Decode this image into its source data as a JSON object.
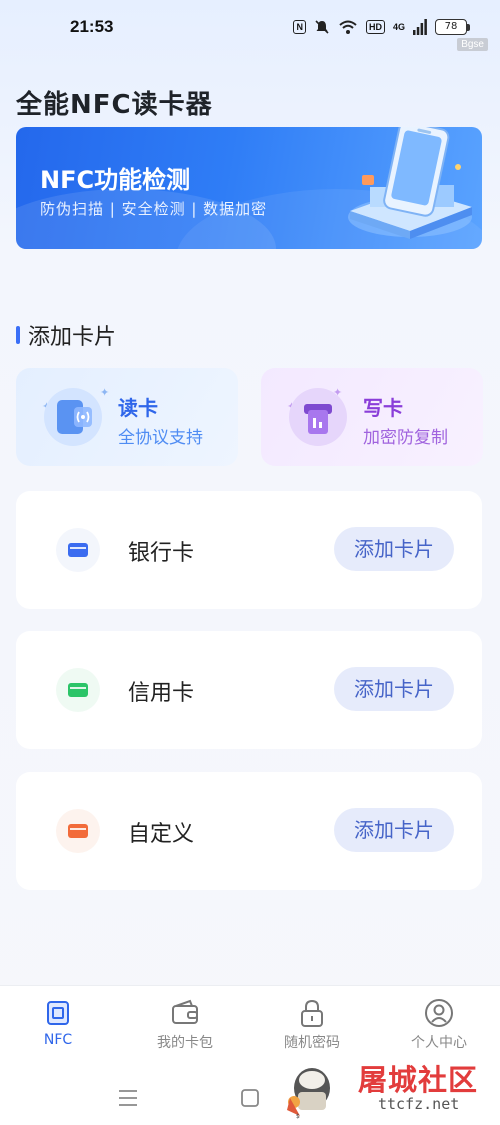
{
  "status_bar": {
    "time": "21:53",
    "nfc_indicator": "N",
    "hd_badge": "HD",
    "network": "4G",
    "battery": "78",
    "corner_tag": "Bgse"
  },
  "app": {
    "title": "全能NFC读卡器"
  },
  "banner": {
    "title": "NFC功能检测",
    "subtitle": "防伪扫描 | 安全检测 | 数据加密"
  },
  "section": {
    "title": "添加卡片"
  },
  "actions": [
    {
      "title": "读卡",
      "subtitle": "全协议支持",
      "icon": "nfc-read-icon"
    },
    {
      "title": "写卡",
      "subtitle": "加密防复制",
      "icon": "card-write-icon"
    }
  ],
  "cards": [
    {
      "label": "银行卡",
      "button": "添加卡片",
      "icon": "bank-card-icon",
      "color": "#3b6cf0"
    },
    {
      "label": "信用卡",
      "button": "添加卡片",
      "icon": "credit-card-icon",
      "color": "#2cc468"
    },
    {
      "label": "自定义",
      "button": "添加卡片",
      "icon": "custom-card-icon",
      "color": "#f26b3a"
    }
  ],
  "tabs": [
    {
      "label": "NFC",
      "icon": "nfc-tab-icon",
      "active": true
    },
    {
      "label": "我的卡包",
      "icon": "wallet-icon",
      "active": false
    },
    {
      "label": "随机密码",
      "icon": "lock-icon",
      "active": false
    },
    {
      "label": "个人中心",
      "icon": "user-icon",
      "active": false
    }
  ],
  "watermark": {
    "name": "屠城社区",
    "url": "ttcfz.net"
  },
  "colors": {
    "accent": "#2f66ea",
    "banner": "#2f7df6",
    "write_accent": "#8a3ed9"
  }
}
